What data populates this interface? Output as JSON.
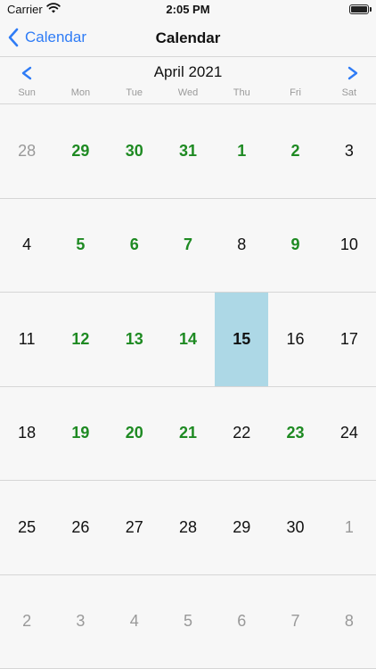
{
  "status_bar": {
    "carrier": "Carrier",
    "time": "2:05 PM"
  },
  "nav": {
    "back_label": "Calendar",
    "title": "Calendar"
  },
  "month_header": {
    "title": "April 2021"
  },
  "weekdays": [
    "Sun",
    "Mon",
    "Tue",
    "Wed",
    "Thu",
    "Fri",
    "Sat"
  ],
  "weeks": [
    [
      {
        "day": "28",
        "kind": "other"
      },
      {
        "day": "29",
        "kind": "event"
      },
      {
        "day": "30",
        "kind": "event"
      },
      {
        "day": "31",
        "kind": "event"
      },
      {
        "day": "1",
        "kind": "event"
      },
      {
        "day": "2",
        "kind": "event"
      },
      {
        "day": "3",
        "kind": "normal"
      }
    ],
    [
      {
        "day": "4",
        "kind": "normal"
      },
      {
        "day": "5",
        "kind": "event"
      },
      {
        "day": "6",
        "kind": "event"
      },
      {
        "day": "7",
        "kind": "event"
      },
      {
        "day": "8",
        "kind": "normal"
      },
      {
        "day": "9",
        "kind": "event"
      },
      {
        "day": "10",
        "kind": "normal"
      }
    ],
    [
      {
        "day": "11",
        "kind": "normal"
      },
      {
        "day": "12",
        "kind": "event"
      },
      {
        "day": "13",
        "kind": "event"
      },
      {
        "day": "14",
        "kind": "event"
      },
      {
        "day": "15",
        "kind": "today"
      },
      {
        "day": "16",
        "kind": "normal"
      },
      {
        "day": "17",
        "kind": "normal"
      }
    ],
    [
      {
        "day": "18",
        "kind": "normal"
      },
      {
        "day": "19",
        "kind": "event"
      },
      {
        "day": "20",
        "kind": "event"
      },
      {
        "day": "21",
        "kind": "event"
      },
      {
        "day": "22",
        "kind": "normal"
      },
      {
        "day": "23",
        "kind": "event"
      },
      {
        "day": "24",
        "kind": "normal"
      }
    ],
    [
      {
        "day": "25",
        "kind": "normal"
      },
      {
        "day": "26",
        "kind": "normal"
      },
      {
        "day": "27",
        "kind": "normal"
      },
      {
        "day": "28",
        "kind": "normal"
      },
      {
        "day": "29",
        "kind": "normal"
      },
      {
        "day": "30",
        "kind": "normal"
      },
      {
        "day": "1",
        "kind": "other"
      }
    ],
    [
      {
        "day": "2",
        "kind": "other"
      },
      {
        "day": "3",
        "kind": "other"
      },
      {
        "day": "4",
        "kind": "other"
      },
      {
        "day": "5",
        "kind": "other"
      },
      {
        "day": "6",
        "kind": "other"
      },
      {
        "day": "7",
        "kind": "other"
      },
      {
        "day": "8",
        "kind": "other"
      }
    ]
  ],
  "colors": {
    "accent": "#2f7cf6",
    "event_day": "#1e8a22",
    "selected_bg": "#add8e6",
    "other_month": "#999999"
  },
  "icons": {
    "back": "chevron-left-icon",
    "prev": "chevron-left-icon",
    "next": "chevron-right-icon",
    "wifi": "wifi-icon",
    "battery": "battery-icon"
  }
}
